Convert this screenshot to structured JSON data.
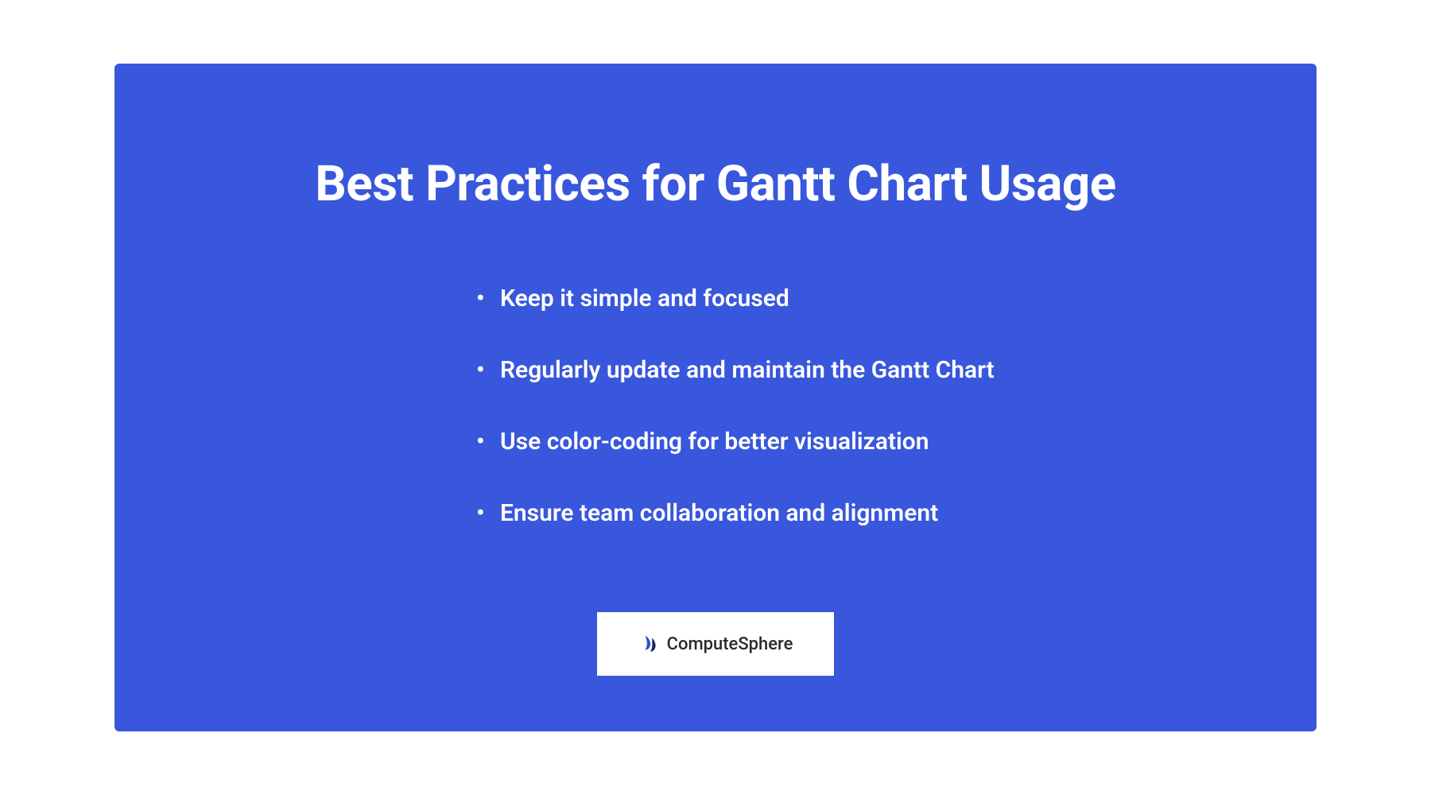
{
  "title": "Best Practices for Gantt Chart Usage",
  "bullets": {
    "item0": "Keep it simple and focused",
    "item1": "Regularly update and maintain the Gantt Chart",
    "item2": "Use color-coding for better visualization",
    "item3": "Ensure team collaboration and alignment"
  },
  "logo": {
    "text": "ComputeSphere"
  },
  "colors": {
    "background": "#3857dc",
    "text": "#ffffff",
    "logoBox": "#ffffff",
    "logoText": "#2a2a2a",
    "logoIcon": "#2850d8"
  }
}
